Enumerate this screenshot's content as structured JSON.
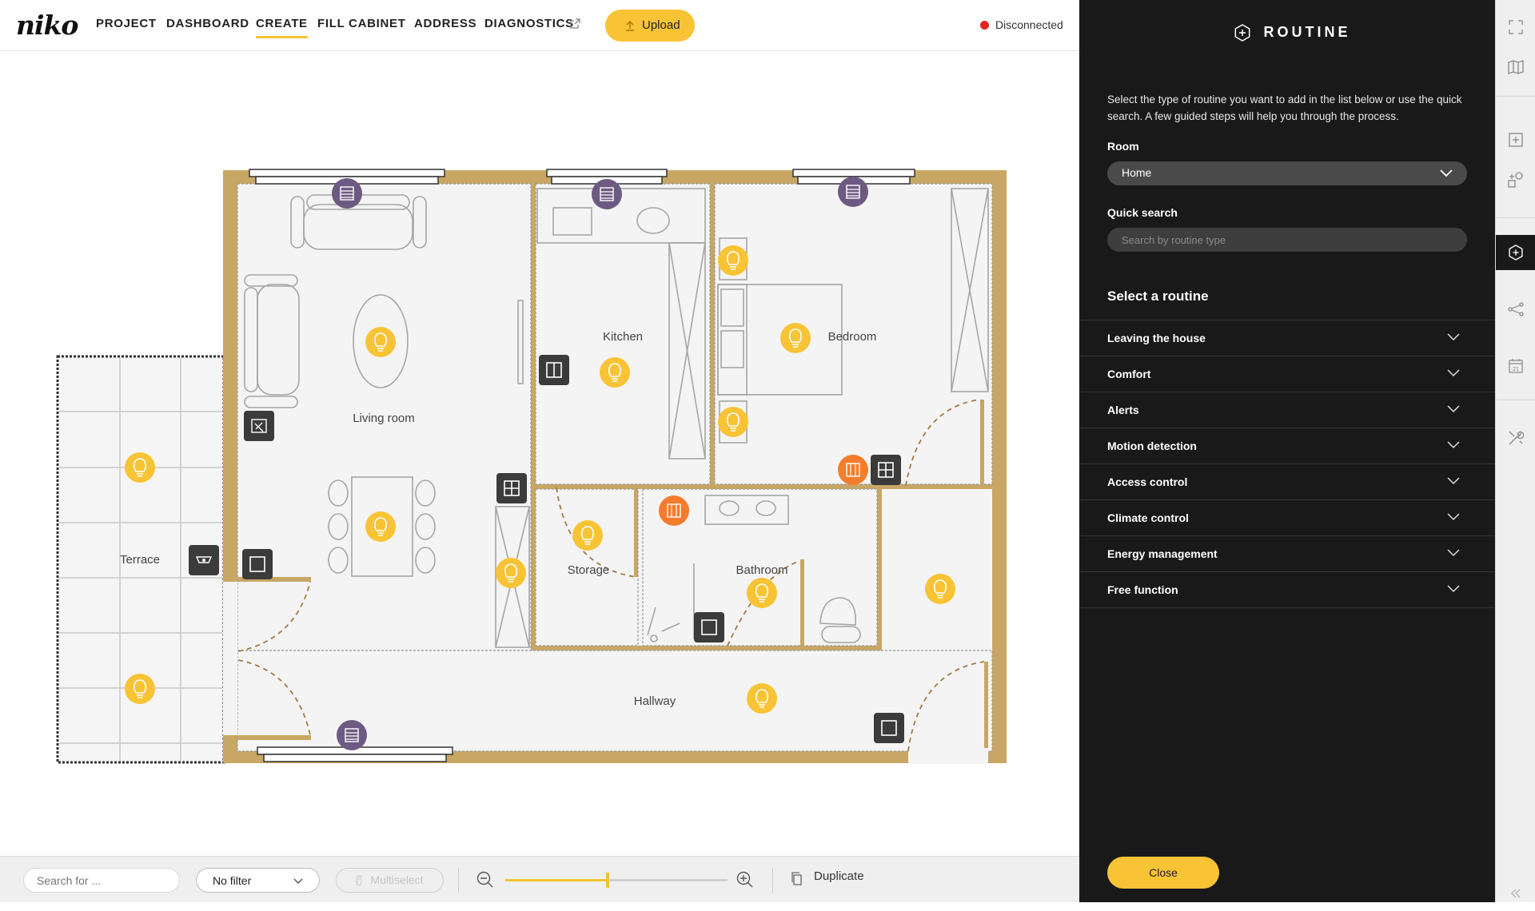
{
  "brand": {
    "logo": "niko"
  },
  "nav": {
    "items": [
      {
        "label": "PROJECT"
      },
      {
        "label": "DASHBOARD"
      },
      {
        "label": "CREATE"
      },
      {
        "label": "FILL CABINET"
      },
      {
        "label": "ADDRESS"
      },
      {
        "label": "DIAGNOSTICS"
      }
    ],
    "active": "CREATE",
    "upload_label": "Upload"
  },
  "status": {
    "text": "Disconnected",
    "color": "#e52420"
  },
  "floorplan": {
    "rooms": [
      {
        "name": "Living room"
      },
      {
        "name": "Kitchen"
      },
      {
        "name": "Bedroom"
      },
      {
        "name": "Terrace"
      },
      {
        "name": "Storage"
      },
      {
        "name": "Bathroom"
      },
      {
        "name": "Hallway"
      }
    ],
    "colors": {
      "wall": "#c8a764",
      "light": "#f8c335",
      "motor": "#6d5a82",
      "heating": "#f47c2c",
      "switch": "#3b3b3b"
    }
  },
  "toolbar": {
    "search_placeholder": "Search for ...",
    "filter_value": "No filter",
    "multiselect_label": "Multiselect",
    "zoom_level": 0.46,
    "duplicate_label": "Duplicate"
  },
  "panel": {
    "title": "ROUTINE",
    "description": "Select the type of routine you want to add in the list below or use the quick search. A few guided steps will help you through the process.",
    "room_label": "Room",
    "room_value": "Home",
    "quick_search_label": "Quick search",
    "quick_search_placeholder": "Search by routine type",
    "select_title": "Select a routine",
    "routines": [
      {
        "label": "Leaving the house"
      },
      {
        "label": "Comfort"
      },
      {
        "label": "Alerts"
      },
      {
        "label": "Motion detection"
      },
      {
        "label": "Access control"
      },
      {
        "label": "Climate control"
      },
      {
        "label": "Energy management"
      },
      {
        "label": "Free function"
      }
    ],
    "close_label": "Close"
  },
  "rail": {
    "icons": [
      "fullscreen-icon",
      "map-icon",
      "add-device-icon",
      "add-shapes-icon",
      "routine-add-icon",
      "connections-icon",
      "calendar-icon",
      "tools-icon",
      "collapse-icon"
    ],
    "calendar_day": "21",
    "active": "routine-add-icon"
  }
}
